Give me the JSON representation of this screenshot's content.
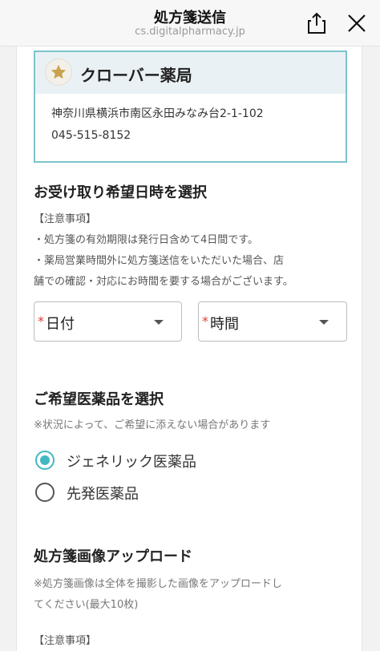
{
  "header": {
    "title": "処方箋送信",
    "url": "cs.digitalpharmacy.jp",
    "share_icon": "share-icon",
    "close_icon": "close-icon"
  },
  "pharmacy": {
    "icon": "star-icon",
    "name": "クローバー薬局",
    "address": "神奈川県横浜市南区永田みなみ台2-1-102",
    "phone": "045-515-8152"
  },
  "pickup": {
    "title": "お受け取り希望日時を選択",
    "notes": [
      "【注意事項】",
      "・処方箋の有効期限は発行日含めて4日間です。",
      "・薬局営業時間外に処方箋送信をいただいた場合、店",
      "舗での確認・対応にお時間を要する場合がございます。"
    ],
    "date_select": {
      "required_mark": "*",
      "label": "日付"
    },
    "time_select": {
      "required_mark": "*",
      "label": "時間"
    }
  },
  "medicine": {
    "title": "ご希望医薬品を選択",
    "note": "※状況によって、ご希望に添えない場合があります",
    "options": [
      {
        "label": "ジェネリック医薬品",
        "checked": true
      },
      {
        "label": "先発医薬品",
        "checked": false
      }
    ]
  },
  "upload": {
    "title": "処方箋画像アップロード",
    "note_lines": [
      "※処方箋画像は全体を撮影した画像をアップロードし",
      "てください(最大10枚)"
    ],
    "notes_heading": "【注意事項】"
  },
  "colors": {
    "accent": "#42b7c2",
    "card_border": "#7cc3cc",
    "required": "#e53935"
  }
}
